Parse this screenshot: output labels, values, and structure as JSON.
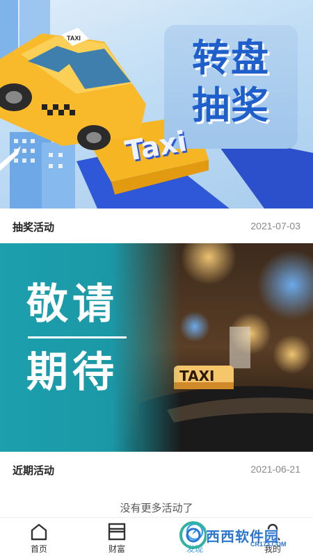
{
  "feed": {
    "items": [
      {
        "banner_text": [
          "转盘",
          "抽奖"
        ],
        "title": "抽奖活动",
        "date": "2021-07-03",
        "taxi_sign": "Taxi"
      },
      {
        "banner_text": [
          "敬请",
          "期待"
        ],
        "title": "近期活动",
        "date": "2021-06-21",
        "taxi_sign": "TAXI"
      }
    ],
    "end_message": "没有更多活动了"
  },
  "tabbar": {
    "tabs": [
      {
        "label": "首页",
        "icon": "home-icon"
      },
      {
        "label": "财富",
        "icon": "wallet-icon"
      },
      {
        "label": "发现",
        "icon": "discover-icon",
        "active": true
      },
      {
        "label": "我的",
        "icon": "profile-icon"
      }
    ]
  },
  "watermark": {
    "text": "西西软件园",
    "sub": "CR173.COM"
  },
  "colors": {
    "accent": "#3aa0f0",
    "banner1_title": "#1f5fcc",
    "banner2_teal": "#1b98a6",
    "taxi_yellow": "#f6b623"
  }
}
